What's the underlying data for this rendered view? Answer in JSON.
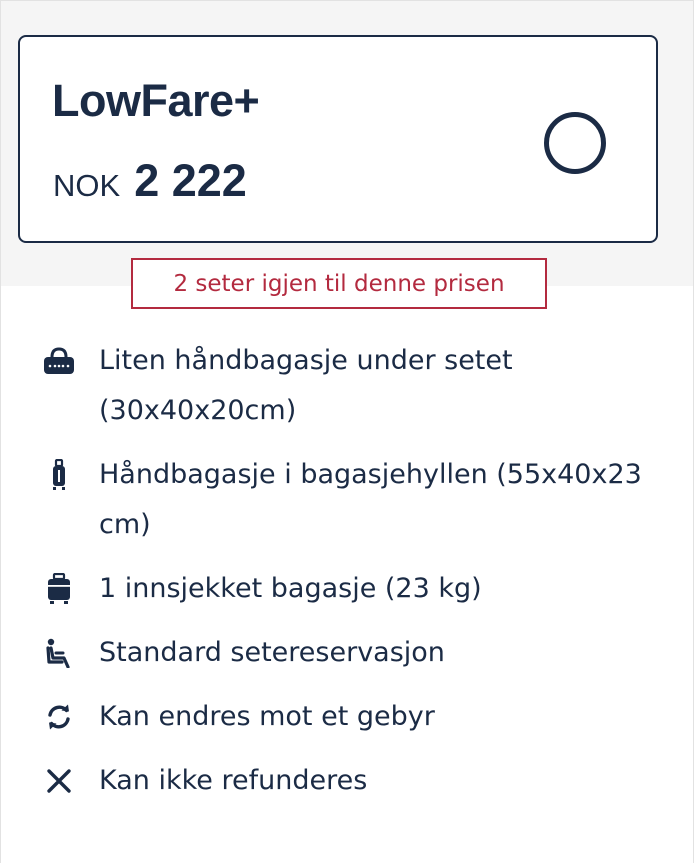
{
  "fare": {
    "name": "LowFare+",
    "currency": "NOK",
    "amount": "2 222",
    "selected": false
  },
  "availability": {
    "text": "2 seter igjen til denne prisen"
  },
  "features": [
    {
      "icon": "small-bag-icon",
      "text": "Liten håndbagasje under setet (30x40x20cm)"
    },
    {
      "icon": "cabin-bag-icon",
      "text": "Håndbagasje i bagasjehyllen (55x40x23 cm)"
    },
    {
      "icon": "checked-bag-icon",
      "text": "1 innsjekket bagasje (23 kg)"
    },
    {
      "icon": "seat-icon",
      "text": "Standard setereservasjon"
    },
    {
      "icon": "change-icon",
      "text": "Kan endres mot et gebyr"
    },
    {
      "icon": "close-icon",
      "text": "Kan ikke refunderes"
    }
  ],
  "colors": {
    "text": "#1b2b45",
    "accent_red": "#b32a3f",
    "band": "#f5f5f5"
  }
}
